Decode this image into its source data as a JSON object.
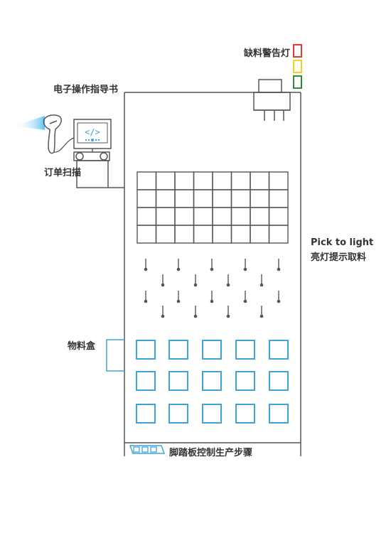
{
  "labels": {
    "warning_light": "缺料警告灯",
    "electronic_guide": "电子操作指导书",
    "order_scan": "订单扫描",
    "pick_to_light_en": "Pick to light",
    "pick_to_light_cn": "亮灯提示取料",
    "material_box": "物料盒",
    "foot_pedal": "脚踏板控制生产步骤"
  },
  "screen_glyph": "</>",
  "colors": {
    "frame": "#555555",
    "box": "#3fa3d8",
    "light_red": "#e53935",
    "light_yellow": "#f2d21f",
    "light_green": "#2e8b3f",
    "scan_beam": "#5bc0f0"
  },
  "icons": {
    "scanner": "barcode-scanner-icon",
    "monitor": "monitor-icon",
    "pedal": "foot-pedal-icon"
  }
}
